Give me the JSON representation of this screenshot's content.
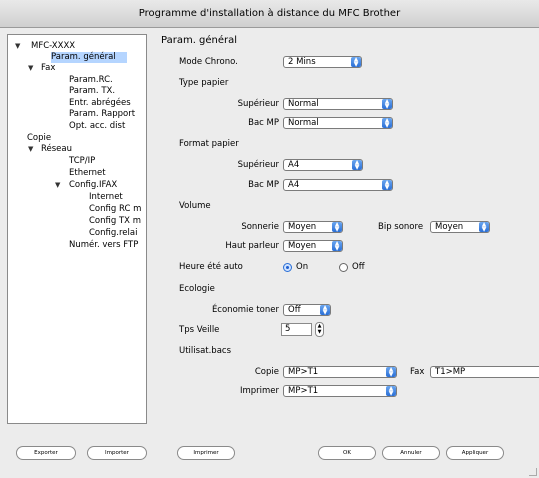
{
  "window": {
    "title": "Programme d'installation à distance du MFC Brother"
  },
  "tree": {
    "items": [
      {
        "label": "MFC-XXXX",
        "expanded": true
      },
      {
        "label": "Param. général",
        "selected": true
      },
      {
        "label": "Fax",
        "expanded": true
      },
      {
        "label": "Param.RC."
      },
      {
        "label": "Param. TX."
      },
      {
        "label": "Entr. abrégées"
      },
      {
        "label": "Param. Rapport"
      },
      {
        "label": "Opt. acc. dist"
      },
      {
        "label": "Copie"
      },
      {
        "label": "Réseau",
        "expanded": true
      },
      {
        "label": "TCP/IP"
      },
      {
        "label": "Ethernet"
      },
      {
        "label": "Config.IFAX",
        "expanded": true
      },
      {
        "label": "Internet"
      },
      {
        "label": "Config RC m"
      },
      {
        "label": "Config TX m"
      },
      {
        "label": "Config.relai"
      },
      {
        "label": "Numér. vers FTP"
      }
    ]
  },
  "panel": {
    "title": "Param. général",
    "mode_chrono": {
      "label": "Mode Chrono.",
      "value": "2 Mins"
    },
    "type_papier": {
      "section": "Type papier",
      "superieur": {
        "label": "Supérieur",
        "value": "Normal"
      },
      "bac_mp": {
        "label": "Bac MP",
        "value": "Normal"
      }
    },
    "format_papier": {
      "section": "Format papier",
      "superieur": {
        "label": "Supérieur",
        "value": "A4"
      },
      "bac_mp": {
        "label": "Bac MP",
        "value": "A4"
      }
    },
    "volume": {
      "section": "Volume",
      "sonnerie": {
        "label": "Sonnerie",
        "value": "Moyen"
      },
      "bip": {
        "label": "Bip sonore",
        "value": "Moyen"
      },
      "haut_parleur": {
        "label": "Haut parleur",
        "value": "Moyen"
      }
    },
    "heure_ete": {
      "label": "Heure été auto",
      "on": "On",
      "off": "Off",
      "selected": "On"
    },
    "ecologie": {
      "section": "Ecologie",
      "economie": {
        "label": "Économie toner",
        "value": "Off"
      }
    },
    "tps_veille": {
      "label": "Tps Veille",
      "value": "5"
    },
    "utilisat": {
      "section": "Utilisat.bacs",
      "copie": {
        "label": "Copie",
        "value": "MP>T1"
      },
      "fax": {
        "label": "Fax",
        "value": "T1>MP"
      },
      "imprimer": {
        "label": "Imprimer",
        "value": "MP>T1"
      }
    }
  },
  "buttons": {
    "exporter": "Exporter",
    "importer": "Importer",
    "imprimer": "Imprimer",
    "ok": "OK",
    "annuler": "Annuler",
    "appliquer": "Appliquer"
  }
}
